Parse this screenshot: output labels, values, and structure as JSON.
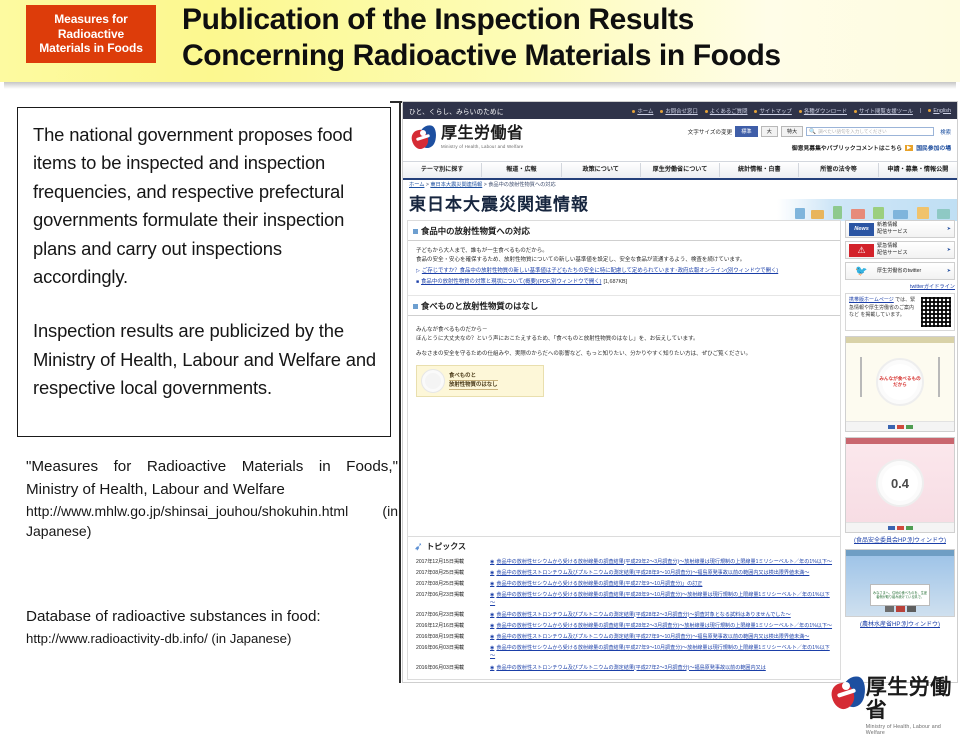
{
  "header": {
    "badge_lines": [
      "Measures for",
      "Radioactive",
      "Materials in Foods"
    ],
    "badge_color": "#dd3c0a",
    "title_line1": "Publication of the Inspection Results",
    "title_line2": "Concerning Radioactive Materials in Foods",
    "band_color": "#fcf88f"
  },
  "textbox": {
    "paragraph1": "The national government proposes food items to be inspected and inspection frequencies, and respective prefectural governments formulate their inspection plans and carry out inspections accordingly.",
    "paragraph2": "Inspection results are publicized by the Ministry of Health, Labour and Welfare and respective local governments."
  },
  "citations": {
    "source1_title": "\"Measures for Radioactive Materials in Foods,\" Ministry of Health, Labour and Welfare",
    "source1_url": "http://www.mhlw.go.jp/shinsai_jouhou/shokuhin.html (in Japanese)",
    "source2_title": "Database of radioactive substances in food:",
    "source2_url": "http://www.radioactivity-db.info/ (in Japanese)"
  },
  "screenshot": {
    "utility_bar": {
      "tagline": "ひと、くらし、みらいのために",
      "links": [
        "ホーム",
        "お問合せ窓口",
        "よくあるご質問",
        "サイトマップ",
        "各種ダウンロード",
        "サイト閲覧支援ツール",
        "English"
      ]
    },
    "logo": {
      "name_jp": "厚生労働省",
      "name_en": "Ministry of Health, Labour and Welfare"
    },
    "font_size": {
      "label": "文字サイズの変更",
      "options": [
        "標準",
        "大",
        "特大"
      ],
      "selected": "標準"
    },
    "search": {
      "placeholder": "調べたい語句を入力してください",
      "button": "検索",
      "icon": "search-icon"
    },
    "public_comment": {
      "text": "御意見募集やパブリックコメントはこちら",
      "link": "国民参加の場"
    },
    "global_nav": [
      "テーマ別に探す",
      "報道・広報",
      "政策について",
      "厚生労働省について",
      "統計情報・白書",
      "所管の法令等",
      "申請・募集・情報公開"
    ],
    "breadcrumb": {
      "home": "ホーム",
      "level2": "東日本大震災関連情報",
      "level3": "食品中の放射性物質への対応"
    },
    "page_title": "東日本大震災関連情報",
    "section1": {
      "heading": "食品中の放射性物質への対応",
      "body_line1": "子どもから大人まで、誰もが一生食べるものだから。",
      "body_line2": "食品の安全・安心を確保するため、放射性物質についての新しい基準値を設定し、安全な食品が流通するよう、検査を続けています。",
      "links": [
        "ご存じですか？食品中の放射性物質の新しい基準値は子どもたちの安全に特に配慮して定められています･政府広報オンライン(別ウィンドウで開く)",
        "食品中の放射性物質の対策と現状について(概要)(PDF,別ウィンドウで開く)"
      ],
      "link2_size": "[1,687KB]"
    },
    "section2": {
      "heading": "食べものと放射性物質のはなし",
      "body_line1": "みんなが食べるものだから－",
      "body_line2": "ほんとうに大丈夫なの？という声におこたえするため、「食べものと放射性物質のはなし」を、お伝えしています。",
      "body_line3": "みなさまの安全を守るための仕組みや、実際のからだへの影響など、もっと知りたい、分かりやすく知りたい方は、ぜひご覧ください。",
      "banner_line1": "食べものと",
      "banner_line2": "放射性物質のはなし"
    },
    "topics": {
      "heading": "トピックス",
      "items": [
        {
          "date": "2017年12月15日掲載",
          "text": "食品中の放射性セシウムから受ける放射線量の調査結果(平成29年2～3月調査分)～放射線量は現行規制の上限線量1ミリシーベルト／年の1%以下～"
        },
        {
          "date": "2017年08月25日掲載",
          "text": "食品中の放射性ストロンチウム及びプルトニウムの測定結果(平成28年9～10月調査分)～福島原発事故以前の範囲内又は検出限界値未満～"
        },
        {
          "date": "2017年08月25日掲載",
          "text": "食品中の放射性セシウムから受ける放射線量の調査結果(平成27年9～10月調査分)」の訂正"
        },
        {
          "date": "2017年06月23日掲載",
          "text": "食品中の放射性セシウムから受ける放射線量の調査結果(平成28年9～10月調査分)～放射線量は現行規制の上限線量1ミリシーベルト／年の1%以下～"
        },
        {
          "date": "2017年06月23日掲載",
          "text": "食品中の放射性ストロンチウム及びプルトニウムの測定結果(平成28年2～3月調査分)～調査対象となる試料はありませんでした～"
        },
        {
          "date": "2016年12月16日掲載",
          "text": "食品中の放射性セシウムから受ける放射線量の調査結果(平成28年2～3月調査分)～放射線量は現行規制の上限線量1ミリシーベルト／年の1%以下～"
        },
        {
          "date": "2016年08月19日掲載",
          "text": "食品中の放射性ストロンチウム及びプルトニウムの測定結果(平成27年9～10月調査分)～福島原発事故以前の範囲内又は検出限界値未満～"
        },
        {
          "date": "2016年06月03日掲載",
          "text": "食品中の放射性セシウムから受ける放射線量の調査結果(平成27年9～10月調査分)～放射線量は現行規制の上限線量1ミリシーベルト／年の1%以下～"
        },
        {
          "date": "2016年06月03日掲載",
          "text": "食品中の放射性ストロンチウム及びプルトニウムの測定結果(平成27年2～3月調査分)～福島原発事故以前の範囲内又は"
        }
      ]
    },
    "sidebar": {
      "buttons": [
        {
          "chip": "News",
          "label_line1": "新着情報",
          "label_line2": "配信サービス"
        },
        {
          "chip": "!",
          "label_line1": "緊急情報",
          "label_line2": "配信サービス"
        },
        {
          "chip": "twitter",
          "label_line1": "厚生労働省のtwitter",
          "label_line2": ""
        }
      ],
      "twitter_guideline": "twitterガイドライン",
      "mobile_link": "携帯版ホームページ",
      "mobile_text": "では、緊急情報や厚生労働省のご案内など を掲載しています。",
      "poster1_caption": "",
      "poster1_dish": "みんなが食べるものだから",
      "poster2_number": "0.4",
      "poster2_caption": "(食品安全委員会HP:別ウィンドウ)",
      "poster3_caption": "(農林水産省HP:別ウィンドウ)",
      "poster3_sign": "みなさまへ、住地の食べものを、生産者側が取り組み続けている県で。"
    }
  },
  "footer_logo": {
    "name_jp": "厚生労働省",
    "name_en": "Ministry of Health, Labour and Welfare"
  }
}
